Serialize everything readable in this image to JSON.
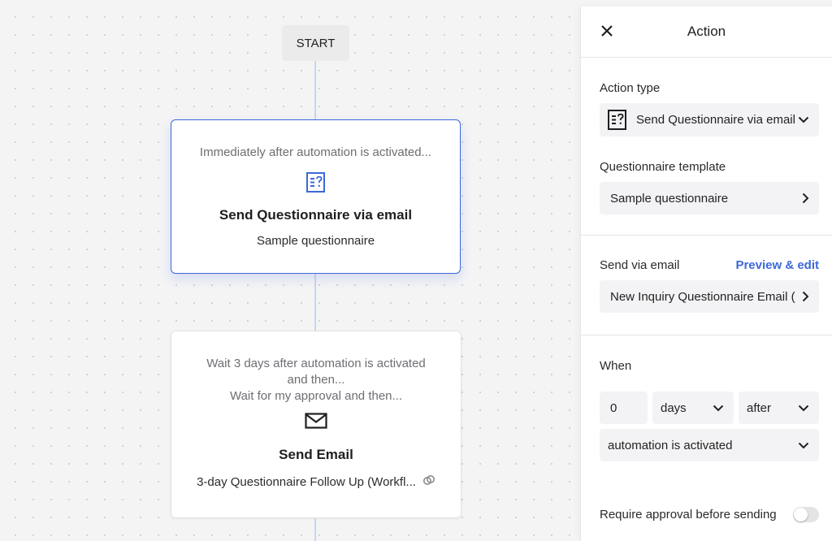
{
  "canvas": {
    "start_label": "START",
    "nodes": [
      {
        "trigger": "Immediately after automation is activated...",
        "icon": "questionnaire-icon",
        "title": "Send Questionnaire via email",
        "subtitle": "Sample questionnaire"
      },
      {
        "trigger_line1": "Wait 3 days after automation is activated",
        "trigger_line2": "and then...",
        "trigger_line3": "Wait for my approval and then...",
        "icon": "envelope-icon",
        "title": "Send Email",
        "subtitle": "3-day Questionnaire Follow Up (Workfl...",
        "subtitle_icon": "link-icon"
      }
    ]
  },
  "panel": {
    "title": "Action",
    "action_type": {
      "label": "Action type",
      "value": "Send Questionnaire via email",
      "icon": "questionnaire-icon"
    },
    "questionnaire_template": {
      "label": "Questionnaire template",
      "value": "Sample questionnaire"
    },
    "send_via_email": {
      "label": "Send via email",
      "link": "Preview & edit",
      "value": "New Inquiry Questionnaire Email ("
    },
    "when": {
      "label": "When",
      "amount": "0",
      "unit": "days",
      "relation": "after",
      "trigger": "automation is activated"
    },
    "approval": {
      "label": "Require approval before sending",
      "enabled": false
    }
  },
  "colors": {
    "accent": "#3d68d8",
    "canvas_bg": "#f4f4f5",
    "field_bg": "#f3f3f5"
  }
}
